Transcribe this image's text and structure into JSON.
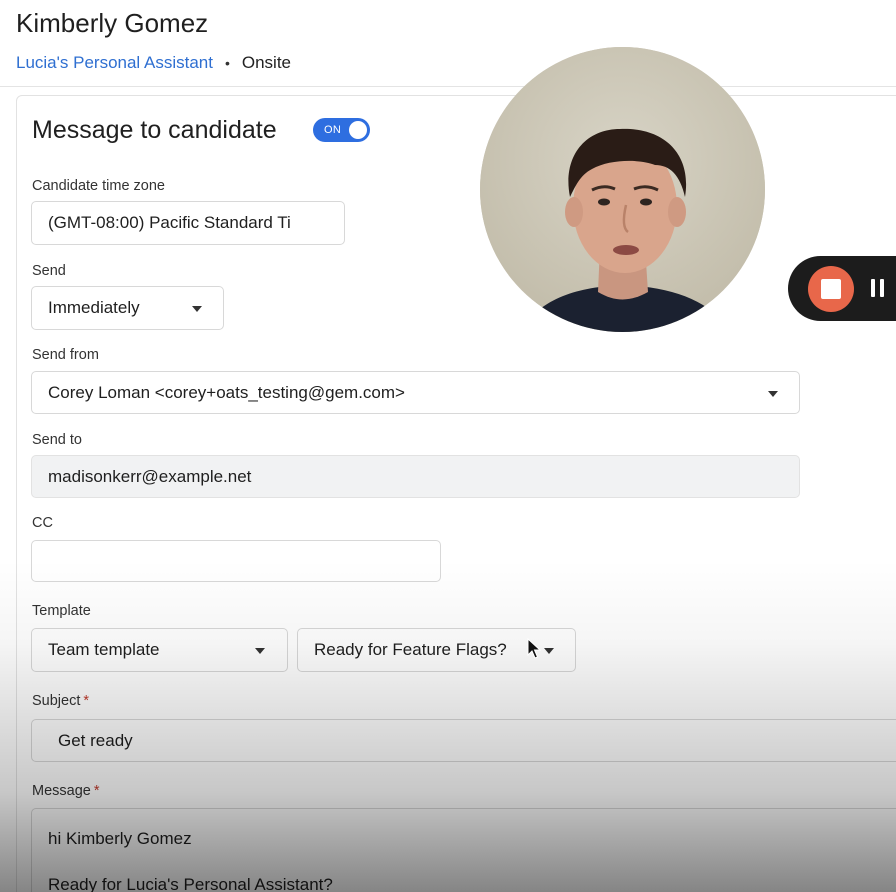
{
  "header": {
    "candidate_name": "Kimberly Gomez",
    "job_link": "Lucia's Personal Assistant",
    "separator": "•",
    "stage": "Onsite"
  },
  "panel": {
    "title": "Message to candidate",
    "toggle_label": "ON"
  },
  "form": {
    "timezone": {
      "label": "Candidate time zone",
      "value": "(GMT-08:00) Pacific Standard Ti"
    },
    "send": {
      "label": "Send",
      "value": "Immediately"
    },
    "send_from": {
      "label": "Send from",
      "value": "Corey Loman <corey+oats_testing@gem.com>"
    },
    "send_to": {
      "label": "Send to",
      "value": "madisonkerr@example.net"
    },
    "cc": {
      "label": "CC",
      "value": ""
    },
    "template": {
      "label": "Template",
      "type_value": "Team template",
      "name_value": "Ready for Feature Flags?"
    },
    "subject": {
      "label": "Subject",
      "required_mark": "*",
      "value": "Get ready"
    },
    "message": {
      "label": "Message",
      "required_mark": "*",
      "line1": "hi Kimberly Gomez",
      "line2": "Ready for Lucia's Personal Assistant?"
    }
  },
  "recorder": {
    "stop_icon": "stop-square-icon",
    "pause_icon": "pause-icon",
    "accent_color": "#e8674a"
  }
}
